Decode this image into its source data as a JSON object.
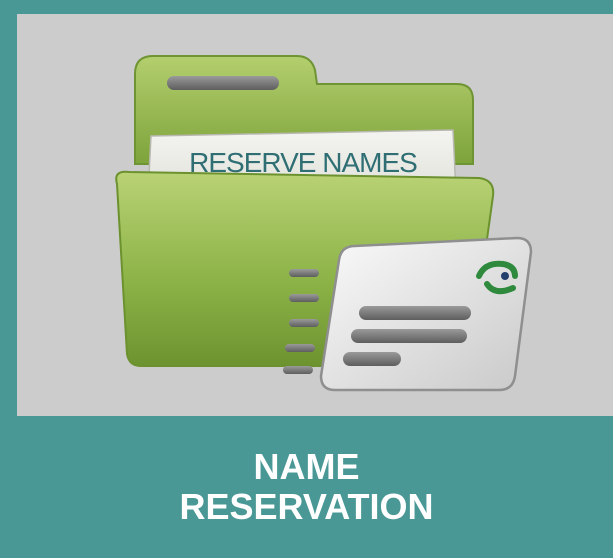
{
  "tile": {
    "title_line1": "NAME",
    "title_line2": "RESERVATION",
    "illustration": {
      "folder_tab_text": "RESERVE NAMES",
      "icon": "folder-with-card-icon"
    }
  },
  "colors": {
    "tile_background": "#4a9896",
    "image_background": "#cccccc",
    "folder_green": "#8fb547",
    "label_text": "#ffffff"
  }
}
